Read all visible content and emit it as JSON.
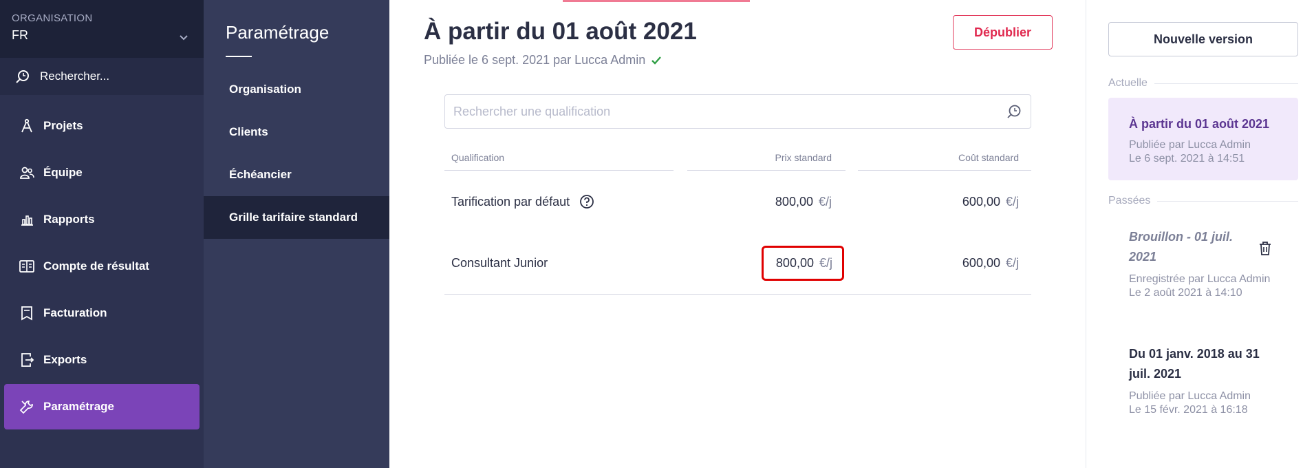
{
  "nav": {
    "org_label": "ORGANISATION",
    "org_value": "FR",
    "search_label": "Rechercher...",
    "items": [
      {
        "label": "Projets",
        "icon": "compass-icon"
      },
      {
        "label": "Équipe",
        "icon": "users-icon"
      },
      {
        "label": "Rapports",
        "icon": "bar-chart-icon"
      },
      {
        "label": "Compte de résultat",
        "icon": "book-icon"
      },
      {
        "label": "Facturation",
        "icon": "invoice-icon"
      },
      {
        "label": "Exports",
        "icon": "export-icon"
      },
      {
        "label": "Paramétrage",
        "icon": "tools-icon",
        "active": true
      }
    ]
  },
  "subnav": {
    "title": "Paramétrage",
    "items": [
      {
        "label": "Organisation"
      },
      {
        "label": "Clients"
      },
      {
        "label": "Échéancier"
      },
      {
        "label": "Grille tarifaire standard",
        "active": true
      }
    ]
  },
  "main": {
    "title": "À partir du 01 août 2021",
    "subtitle": "Publiée le 6 sept. 2021 par Lucca Admin",
    "unpublish_label": "Dépublier",
    "search_placeholder": "Rechercher une qualification",
    "table": {
      "headers": [
        "Qualification",
        "Prix standard",
        "Coût standard"
      ],
      "rows": [
        {
          "name": "Tarification par défaut",
          "price": "800,00",
          "price_unit": "€/j",
          "cost": "600,00",
          "cost_unit": "€/j",
          "has_help": true
        },
        {
          "name": "Consultant Junior",
          "price": "800,00",
          "price_unit": "€/j",
          "cost": "600,00",
          "cost_unit": "€/j",
          "highlighted": true
        }
      ]
    }
  },
  "panel": {
    "new_version_label": "Nouvelle version",
    "current_label": "Actuelle",
    "current": {
      "title": "À partir du 01 août 2021",
      "meta1": "Publiée par Lucca Admin",
      "meta2": "Le 6 sept. 2021 à 14:51"
    },
    "past_label": "Passées",
    "draft": {
      "title_line1": "Brouillon - 01 juil.",
      "title_line2": "2021",
      "meta1": "Enregistrée par Lucca Admin",
      "meta2": "Le 2 août 2021 à 14:10"
    },
    "past": {
      "title_line1": "Du 01 janv. 2018 au 31",
      "title_line2": "juil. 2021",
      "meta1": "Publiée par Lucca Admin",
      "meta2": "Le 15 févr. 2021 à 16:18"
    }
  },
  "colors": {
    "sidebar": "#2d3250",
    "subnav": "#353b5a",
    "active_purple": "#7b44b8",
    "danger": "#e0294f",
    "highlight_box": "#e00000"
  }
}
